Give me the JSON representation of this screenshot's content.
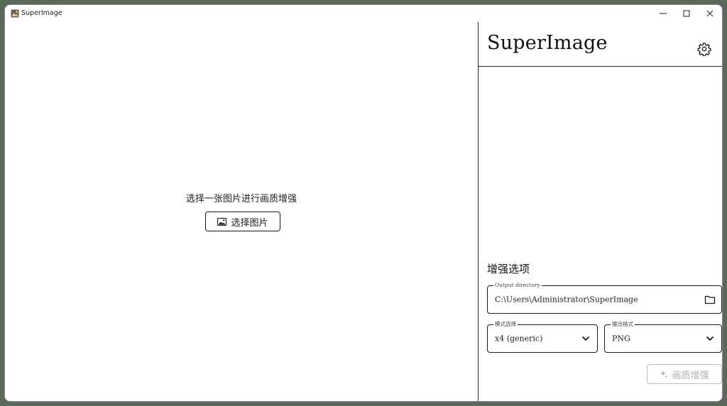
{
  "window": {
    "title": "SuperImage",
    "controls": {
      "minimize": "—",
      "maximize": "☐",
      "close": "✕"
    }
  },
  "left": {
    "prompt": "选择一张图片进行画质增强",
    "select_button_label": "选择图片"
  },
  "panel": {
    "app_name": "SuperImage",
    "section_title": "增强选项",
    "output_directory": {
      "label": "Output directory",
      "value": "C:\\Users\\Administrator\\SuperImage"
    },
    "model": {
      "label": "模式选择",
      "value": "x4 (generic)"
    },
    "format": {
      "label": "输出格式",
      "value": "PNG"
    },
    "enhance_button_label": "画质增强"
  },
  "icons": {
    "app": "app-icon",
    "image": "image-icon",
    "settings": "gear-icon",
    "folder": "folder-icon",
    "dropdown": "chevron-down-icon",
    "enhance": "sparkle-icon"
  },
  "colors": {
    "border": "#1a1a1a",
    "disabled": "#b0b0b0",
    "background": "#ffffff"
  }
}
